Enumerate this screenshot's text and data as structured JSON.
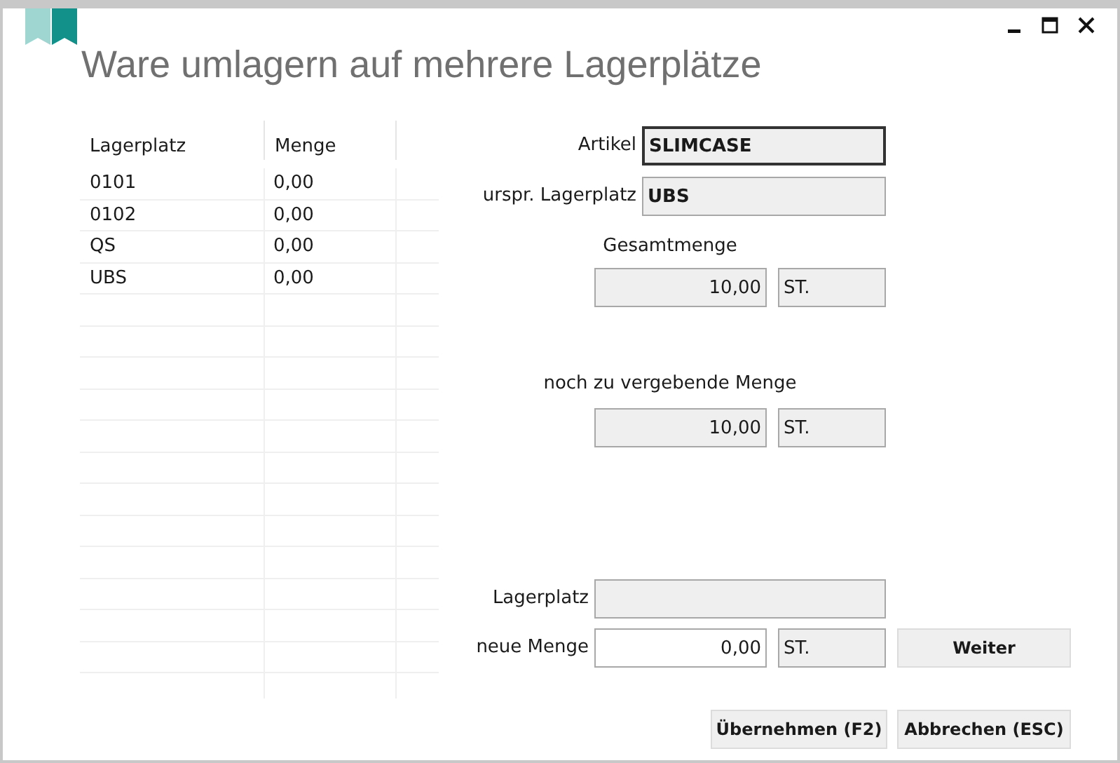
{
  "window": {
    "title": "Ware umlagern auf mehrere Lagerplätze"
  },
  "table": {
    "columns": [
      "Lagerplatz",
      "Menge"
    ],
    "rows": [
      [
        "0101",
        "0,00"
      ],
      [
        "0102",
        "0,00"
      ],
      [
        "QS",
        "0,00"
      ],
      [
        "UBS",
        "0,00"
      ]
    ]
  },
  "form": {
    "artikel": {
      "label": "Artikel",
      "value": "SLIMCASE",
      "focused": true,
      "readonly": true
    },
    "urspr_lagerplatz": {
      "label": "urspr. Lagerplatz",
      "value": "UBS",
      "focused": false,
      "readonly": true
    },
    "gesamtmenge": {
      "label": "Gesamtmenge",
      "value": "10,00",
      "unit": "ST.",
      "readonly": true
    },
    "noch_zu_vergeben": {
      "label": "noch zu vergebende Menge",
      "value": "10,00",
      "unit": "ST.",
      "readonly": true
    },
    "lagerplatz": {
      "label": "Lagerplatz",
      "readonly": true
    },
    "neue_menge": {
      "label": "neue Menge",
      "value": "0,00",
      "unit": "ST.",
      "readonly": false
    },
    "next_button": "Weiter"
  },
  "buttons": [
    "Übernehmen (F2)",
    "Abbrechen (ESC)"
  ]
}
